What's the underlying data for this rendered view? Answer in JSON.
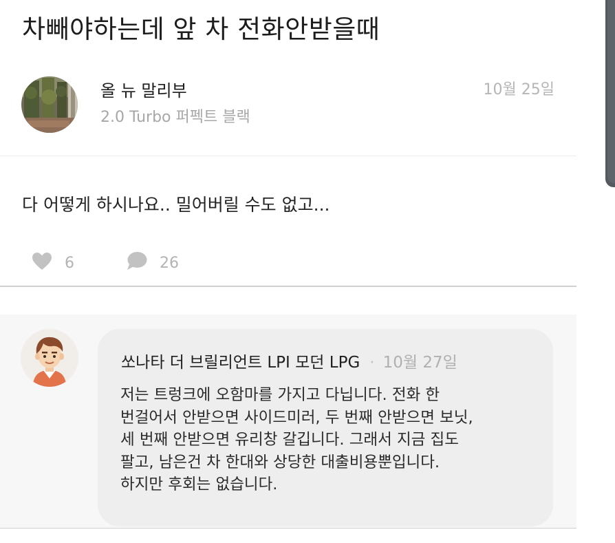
{
  "post": {
    "title": "차빼야하는데 앞 차 전화안받을때",
    "author": {
      "name": "올 뉴 말리부",
      "car": "2.0 Turbo 퍼펙트 블랙"
    },
    "date": "10월 25일",
    "body": "다 어떻게 하시나요.. 밀어버릴 수도 없고...",
    "stats": {
      "likes": "6",
      "comments": "26",
      "like_icon": "heart-icon",
      "comment_icon": "speech-bubble-icon"
    }
  },
  "comment": {
    "author": "쏘나타 더 브릴리언트 LPI 모던 LPG",
    "separator": "·",
    "date": "10월 27일",
    "text": "저는 트렁크에 오함마를 가지고 다닙니다. 전화 한\n번걸어서 안받으면 사이드미러, 두 번째 안받으면 보닛,\n세 번째 안받으면 유리창 갈깁니다. 그래서 지금 집도\n팔고, 남은건 차 한대와 상당한 대출비용뿐입니다.\n하지만 후회는 없습니다."
  },
  "colors": {
    "icon_gray": "#c2c2c2",
    "comment_bg": "#f7f7f7",
    "bubble_bg": "#eeeeee"
  }
}
